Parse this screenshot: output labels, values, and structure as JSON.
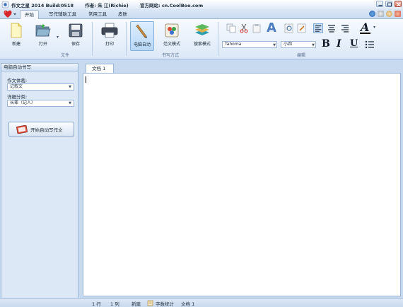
{
  "titlebar": {
    "app_name": "作文之星 2014 Build:0518",
    "author": "作者: 朱 江(Richie)",
    "website": "官方网站: cn.CoolBoo.com"
  },
  "menu": {
    "tabs": [
      {
        "label": "开始",
        "active": true
      },
      {
        "label": "写作辅助工具",
        "active": false
      },
      {
        "label": "常用工具",
        "active": false
      },
      {
        "label": "皮肤",
        "active": false
      }
    ]
  },
  "ribbon": {
    "file_group": {
      "label": "文件",
      "new_label": "新建",
      "open_label": "打开",
      "save_label": "保存",
      "print_label": "打印"
    },
    "mode_group": {
      "label": "书写方式",
      "auto_label": "电脑自动",
      "template_label": "范文模式",
      "search_label": "搜索模式"
    },
    "edit_group": {
      "label": "编辑",
      "font_name": "Tahoma",
      "font_size": "小四",
      "bold": "B",
      "italic": "I",
      "underline": "U",
      "font_color_glyph": "A"
    }
  },
  "left_panel": {
    "title": "电脑自动书写",
    "genre_label": "作文体裁:",
    "genre_value": "记叙文",
    "category_label": "详细分类:",
    "category_value": "长辈（记人）",
    "start_button": "开始自动写作文"
  },
  "document": {
    "tab_label": "文档 1"
  },
  "statusbar": {
    "line": "1 行",
    "col": "1 列",
    "mode": "新建",
    "word_count": "字数统计",
    "doc": "文档 1"
  },
  "colors": {
    "accent": "#3a6fb5",
    "panel_bg": "#dce8f5",
    "border": "#9eb6d6",
    "close_red": "#d9634f"
  }
}
